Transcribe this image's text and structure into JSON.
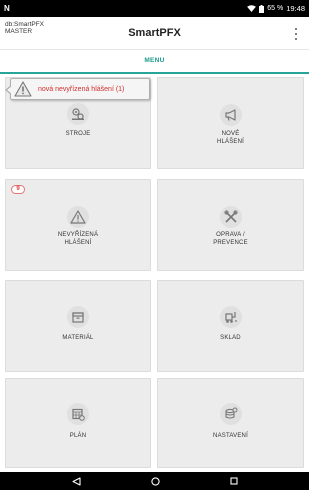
{
  "status_bar": {
    "left_glyph": "N",
    "battery_text": "65 %",
    "time": "19:48"
  },
  "app_bar": {
    "db_line1": "db:SmartPFX",
    "db_line2": "MASTER",
    "title": "SmartPFX",
    "overflow_icon": "more-vert-icon"
  },
  "tab": {
    "label": "MENU",
    "accent_color": "#26a69a"
  },
  "notification": {
    "text": "nová nevyřízená hlášení (1)",
    "icon": "warning-icon",
    "text_color": "#d32f2f"
  },
  "tiles": [
    {
      "label_lines": [
        "STROJE"
      ],
      "icon": "machines-icon",
      "badge": ""
    },
    {
      "label_lines": [
        "NOVÉ",
        "HLÁŠENÍ"
      ],
      "icon": "megaphone-icon",
      "badge": ""
    },
    {
      "label_lines": [
        "NEVYŘÍZENÁ",
        "HLÁŠENÍ"
      ],
      "icon": "warning-icon",
      "badge": "9"
    },
    {
      "label_lines": [
        "OPRAVA /",
        "PREVENCE"
      ],
      "icon": "tools-icon",
      "badge": ""
    },
    {
      "label_lines": [
        "MATERIÁL"
      ],
      "icon": "material-box-icon",
      "badge": ""
    },
    {
      "label_lines": [
        "SKLAD"
      ],
      "icon": "forklift-icon",
      "badge": ""
    },
    {
      "label_lines": [
        "PLÁN"
      ],
      "icon": "calendar-plan-icon",
      "badge": ""
    },
    {
      "label_lines": [
        "NASTAVENÍ"
      ],
      "icon": "settings-database-icon",
      "badge": ""
    }
  ],
  "nav_bar": {
    "back_icon": "back-triangle-icon",
    "home_icon": "home-circle-icon",
    "recents_icon": "recents-square-icon"
  }
}
